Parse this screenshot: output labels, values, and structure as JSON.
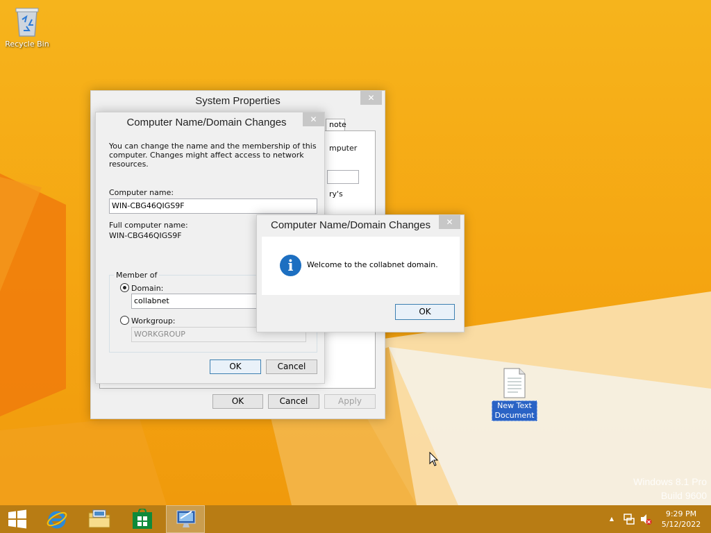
{
  "desktop": {
    "recycle_bin_label": "Recycle Bin",
    "text_document_label_line1": "New Text",
    "text_document_label_line2": "Document",
    "watermark_line1": "Windows 8.1 Pro",
    "watermark_line2": "Build 9600"
  },
  "system_properties": {
    "title": "System Properties",
    "close_glyph": "✕",
    "tab_partial": "note",
    "partial_text_1": "mputer",
    "partial_text_2": "ry's",
    "ok_label": "OK",
    "cancel_label": "Cancel",
    "apply_label": "Apply"
  },
  "name_dialog": {
    "title": "Computer Name/Domain Changes",
    "close_glyph": "✕",
    "description_line1": "You can change the name and the membership of this",
    "description_line2": "computer. Changes might affect access to network resources.",
    "computer_name_label": "Computer name:",
    "computer_name_value": "WIN-CBG46QIGS9F",
    "full_name_label": "Full computer name:",
    "full_name_value": "WIN-CBG46QIGS9F",
    "member_of_label": "Member of",
    "domain_label": "Domain:",
    "domain_value": "collabnet",
    "workgroup_label": "Workgroup:",
    "workgroup_value": "WORKGROUP",
    "selected_membership": "domain",
    "ok_label": "OK",
    "cancel_label": "Cancel"
  },
  "welcome_dialog": {
    "title": "Computer Name/Domain Changes",
    "close_glyph": "✕",
    "icon": "info-icon",
    "icon_glyph": "i",
    "message": "Welcome to the collabnet domain.",
    "ok_label": "OK"
  },
  "taskbar": {
    "apps": [
      "start-button",
      "internet-explorer-icon",
      "file-explorer-icon",
      "store-icon",
      "system-properties-icon"
    ],
    "active_app": "system-properties-icon",
    "tray_arrow_glyph": "▲",
    "time": "9:29 PM",
    "date": "5/12/2022"
  },
  "colors": {
    "desktop_orange": "#f5a511",
    "taskbar": "#b6780c",
    "info_blue": "#1d6fc1",
    "selection_blue": "#2a63c5"
  }
}
